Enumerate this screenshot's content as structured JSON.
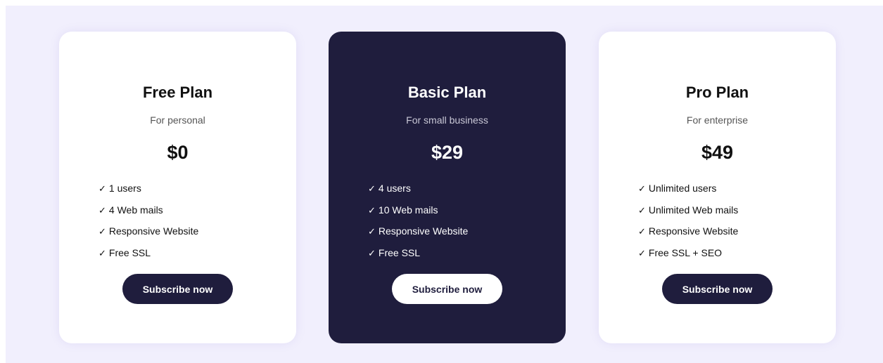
{
  "plans": [
    {
      "title": "Free Plan",
      "subtitle": "For personal",
      "price": "$0",
      "features": [
        "1 users",
        "4 Web mails",
        "Responsive Website",
        "Free SSL"
      ],
      "button_label": "Subscribe now"
    },
    {
      "title": "Basic Plan",
      "subtitle": "For small business",
      "price": "$29",
      "features": [
        "4 users",
        "10 Web mails",
        "Responsive Website",
        "Free SSL"
      ],
      "button_label": "Subscribe now"
    },
    {
      "title": "Pro Plan",
      "subtitle": "For enterprise",
      "price": "$49",
      "features": [
        "Unlimited users",
        "Unlimited Web mails",
        "Responsive Website",
        "Free SSL + SEO"
      ],
      "button_label": "Subscribe now"
    }
  ],
  "feature_marker": "✓",
  "colors": {
    "page_background": "#f1effd",
    "card_background": "#ffffff",
    "highlight_card_background": "#1f1d3d",
    "button_dark": "#1f1d3d",
    "button_light": "#ffffff"
  },
  "icons": {
    "feature_check": "check-icon"
  }
}
